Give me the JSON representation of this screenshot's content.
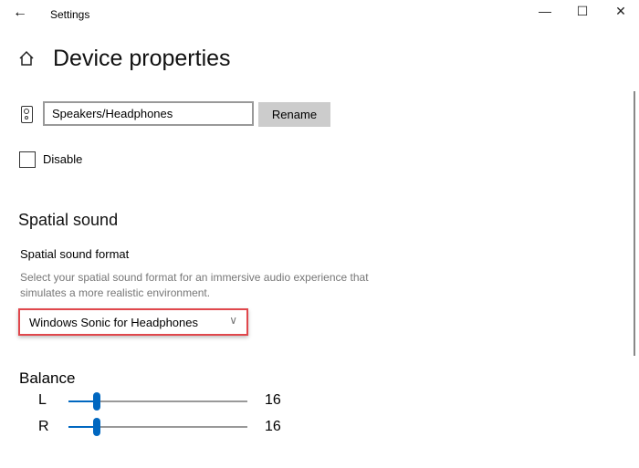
{
  "window": {
    "title": "Settings",
    "minimize": "—",
    "maximize": "☐",
    "close": "✕",
    "back": "←"
  },
  "page": {
    "title": "Device properties"
  },
  "device": {
    "name_value": "Speakers/Headphones",
    "rename_label": "Rename",
    "disable_label": "Disable",
    "disabled": false
  },
  "spatial": {
    "heading": "Spatial sound",
    "format_label": "Spatial sound format",
    "description": "Select your spatial sound format for an immersive audio experience that simulates a more realistic environment.",
    "selected": "Windows Sonic for Headphones",
    "chevron": "∨"
  },
  "balance": {
    "heading": "Balance",
    "channels": [
      {
        "label": "L",
        "value": "16",
        "percent": 16
      },
      {
        "label": "R",
        "value": "16",
        "percent": 16
      }
    ]
  },
  "colors": {
    "accent": "#0067c0",
    "highlight": "#e0474c"
  }
}
